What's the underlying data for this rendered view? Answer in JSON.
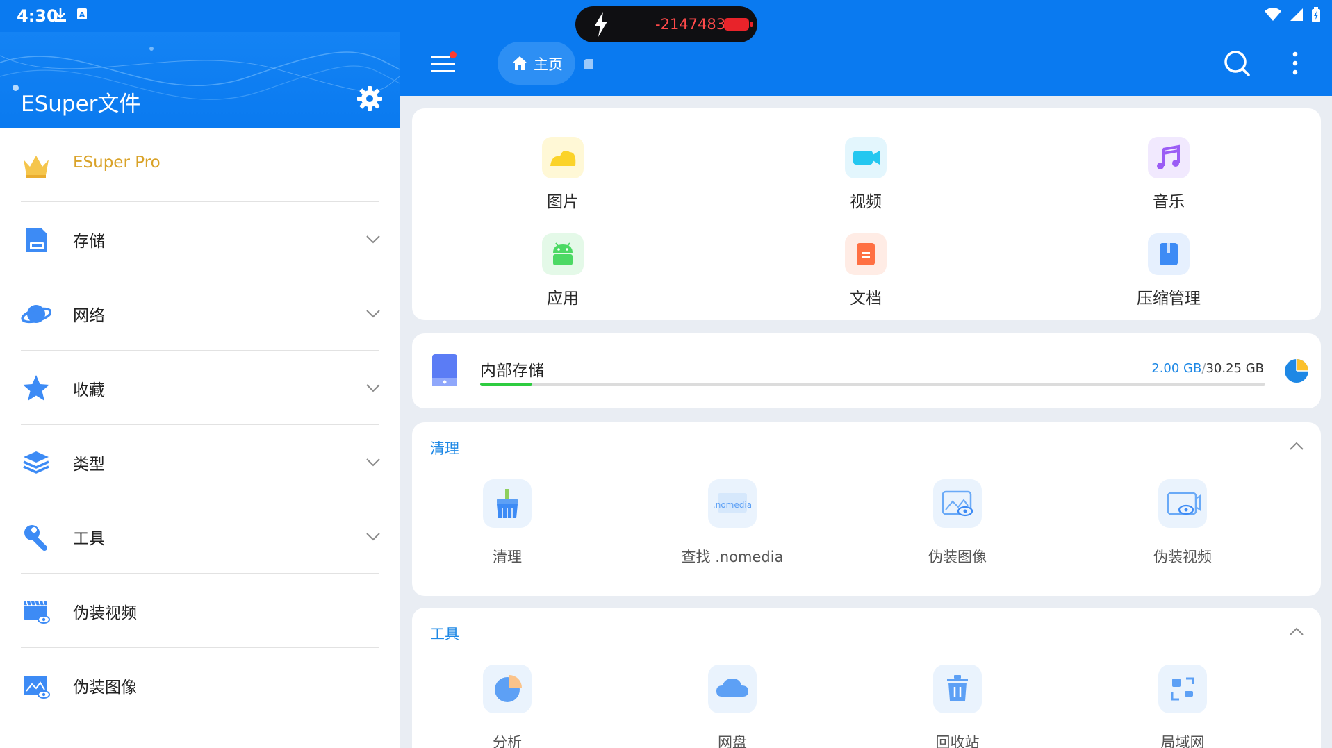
{
  "status_bar": {
    "time": "4:30",
    "pill_value": "-2147483",
    "colors": {
      "bar": "#0a7af0",
      "pill": "#0f0f12",
      "battery": "#e8232a"
    }
  },
  "drawer": {
    "title": "ESuper文件",
    "pro_label": "ESuper Pro",
    "items": [
      {
        "label": "存储",
        "icon": "sd-card-icon",
        "expandable": true
      },
      {
        "label": "网络",
        "icon": "planet-icon",
        "expandable": true
      },
      {
        "label": "收藏",
        "icon": "star-icon",
        "expandable": true
      },
      {
        "label": "类型",
        "icon": "layers-icon",
        "expandable": true
      },
      {
        "label": "工具",
        "icon": "wrench-icon",
        "expandable": true
      },
      {
        "label": "伪装视频",
        "icon": "disguise-video-icon",
        "expandable": false
      },
      {
        "label": "伪装图像",
        "icon": "disguise-image-icon",
        "expandable": false
      }
    ]
  },
  "appbar": {
    "home_label": "主页",
    "has_notification_dot": true
  },
  "categories": [
    {
      "label": "图片",
      "icon": "image-icon",
      "color": "#fbd32a",
      "bg": "#fff8d6"
    },
    {
      "label": "视频",
      "icon": "video-icon",
      "color": "#24c7f0",
      "bg": "#e3f6fd"
    },
    {
      "label": "音乐",
      "icon": "music-icon",
      "color": "#9b5cf5",
      "bg": "#f1e9fe"
    },
    {
      "label": "应用",
      "icon": "android-icon",
      "color": "#4cd964",
      "bg": "#e4f9e8"
    },
    {
      "label": "文档",
      "icon": "document-icon",
      "color": "#ff7043",
      "bg": "#ffece5"
    },
    {
      "label": "压缩管理",
      "icon": "archive-icon",
      "color": "#3d8bf5",
      "bg": "#e6f0fe"
    }
  ],
  "storage": {
    "name": "内部存储",
    "used": "2.00 GB",
    "separator": "/",
    "total": "30.25 GB",
    "used_fraction": 0.066
  },
  "sections": {
    "clean": {
      "title": "清理",
      "items": [
        {
          "label": "清理",
          "icon": "broom-icon"
        },
        {
          "label": "查找 .nomedia",
          "icon": "nomedia-icon",
          "icon_text": ".nomedia"
        },
        {
          "label": "伪装图像",
          "icon": "disguise-image-icon"
        },
        {
          "label": "伪装视频",
          "icon": "disguise-video-icon"
        }
      ]
    },
    "tools": {
      "title": "工具",
      "items": [
        {
          "label": "分析",
          "icon": "pie-chart-icon"
        },
        {
          "label": "网盘",
          "icon": "cloud-icon"
        },
        {
          "label": "回收站",
          "icon": "trash-icon"
        },
        {
          "label": "局域网",
          "icon": "lan-icon"
        }
      ]
    }
  },
  "accent_color": "#1e88e5"
}
